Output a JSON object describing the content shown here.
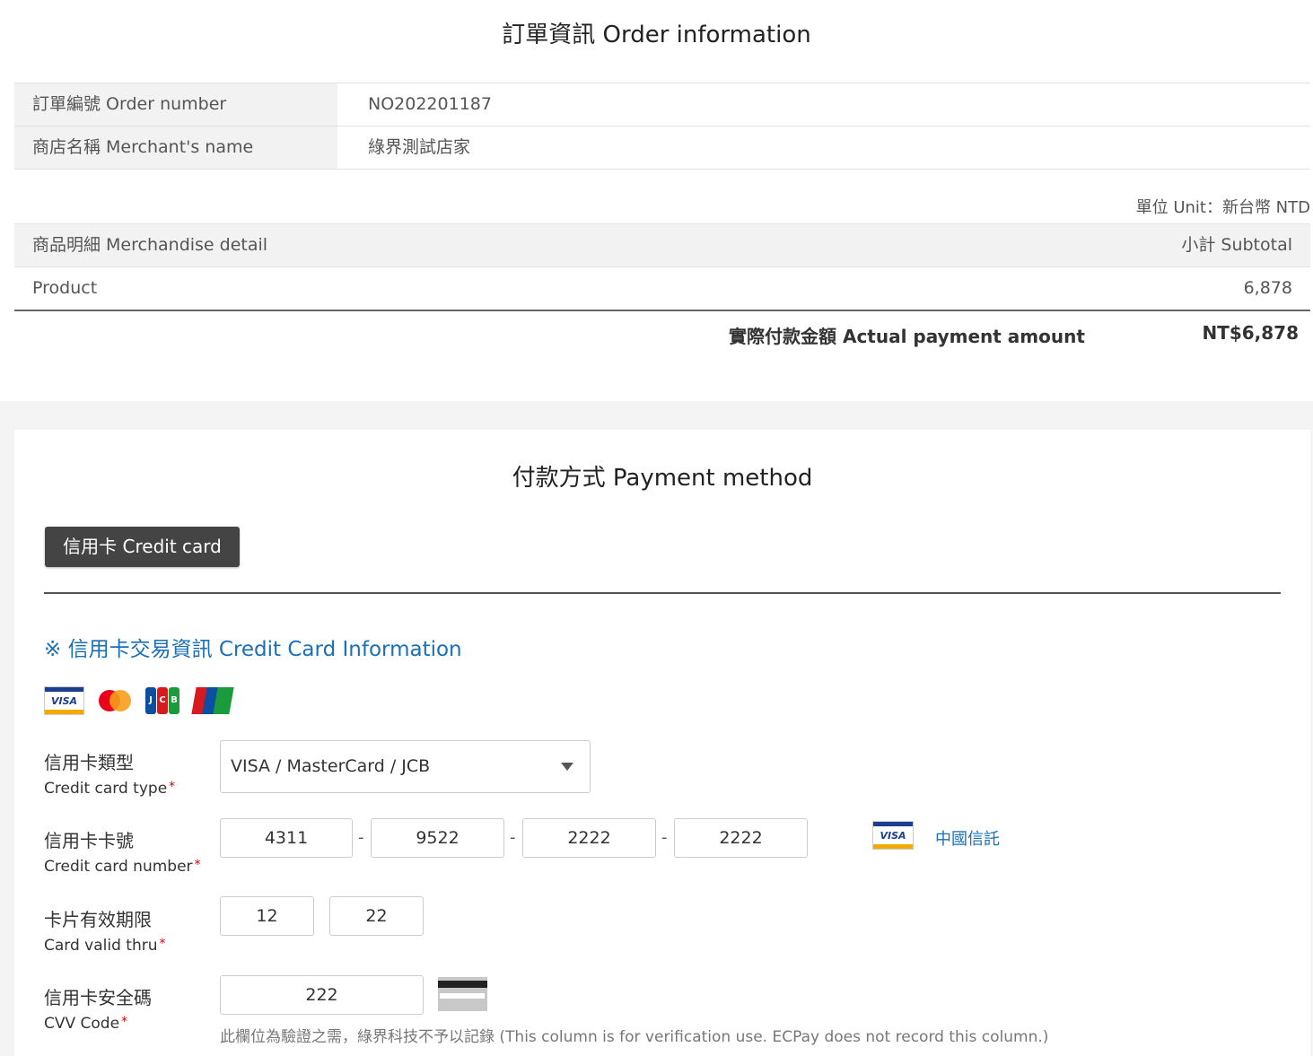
{
  "order": {
    "title": "訂單資訊 Order information",
    "rows": [
      {
        "label": "訂單編號 Order number",
        "value": "NO202201187"
      },
      {
        "label": "商店名稱 Merchant's name",
        "value": "綠界測試店家"
      }
    ],
    "unit_note": "單位 Unit：新台幣 NTD",
    "detail_header": {
      "left": "商品明細 Merchandise detail",
      "right": "小計 Subtotal"
    },
    "items": [
      {
        "name": "Product",
        "subtotal": "6,878"
      }
    ],
    "total_label": "實際付款金額 Actual payment amount",
    "total_value": "NT$6,878"
  },
  "payment": {
    "title": "付款方式 Payment method",
    "tab_label": "信用卡 Credit card",
    "cc_heading": "※ 信用卡交易資訊 Credit Card Information",
    "brands": [
      "VISA",
      "MasterCard",
      "JCB",
      "UnionPay"
    ],
    "card_type": {
      "label_zh": "信用卡類型",
      "label_en": "Credit card type",
      "value": "VISA / MasterCard / JCB"
    },
    "card_number": {
      "label_zh": "信用卡卡號",
      "label_en": "Credit card number",
      "parts": [
        "4311",
        "9522",
        "2222",
        "2222"
      ],
      "separator": "-",
      "detected_brand": "VISA",
      "bank": "中國信託"
    },
    "valid_thru": {
      "label_zh": "卡片有效期限",
      "label_en": "Card valid thru",
      "month": "12",
      "year": "22"
    },
    "cvv": {
      "label_zh": "信用卡安全碼",
      "label_en": "CVV Code",
      "value": "222",
      "note": "此欄位為驗證之需，綠界科技不予以記錄 (This column is for verification use. ECPay does not record this column.)"
    },
    "required_mark": "*"
  },
  "colors": {
    "accent_blue": "#1a6fb5",
    "tab_bg": "#444444",
    "required": "#dd0000"
  }
}
